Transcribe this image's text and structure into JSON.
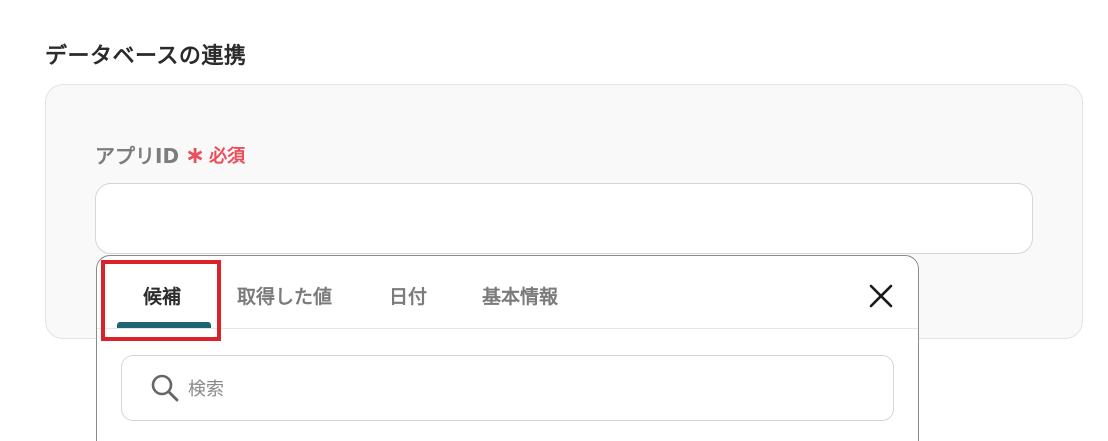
{
  "section": {
    "title": "データベースの連携"
  },
  "field": {
    "label": "アプリID",
    "required_mark": "∗",
    "required_text": "必須",
    "value": ""
  },
  "dropdown": {
    "tabs": [
      {
        "label": "候補",
        "active": true
      },
      {
        "label": "取得した値",
        "active": false
      },
      {
        "label": "日付",
        "active": false
      },
      {
        "label": "基本情報",
        "active": false
      }
    ],
    "close_icon": "close-icon",
    "search": {
      "placeholder": "検索",
      "icon": "search-icon"
    }
  },
  "colors": {
    "required": "#e8505b",
    "active_tab_underline": "#1f6472",
    "highlight": "#d9232a"
  }
}
